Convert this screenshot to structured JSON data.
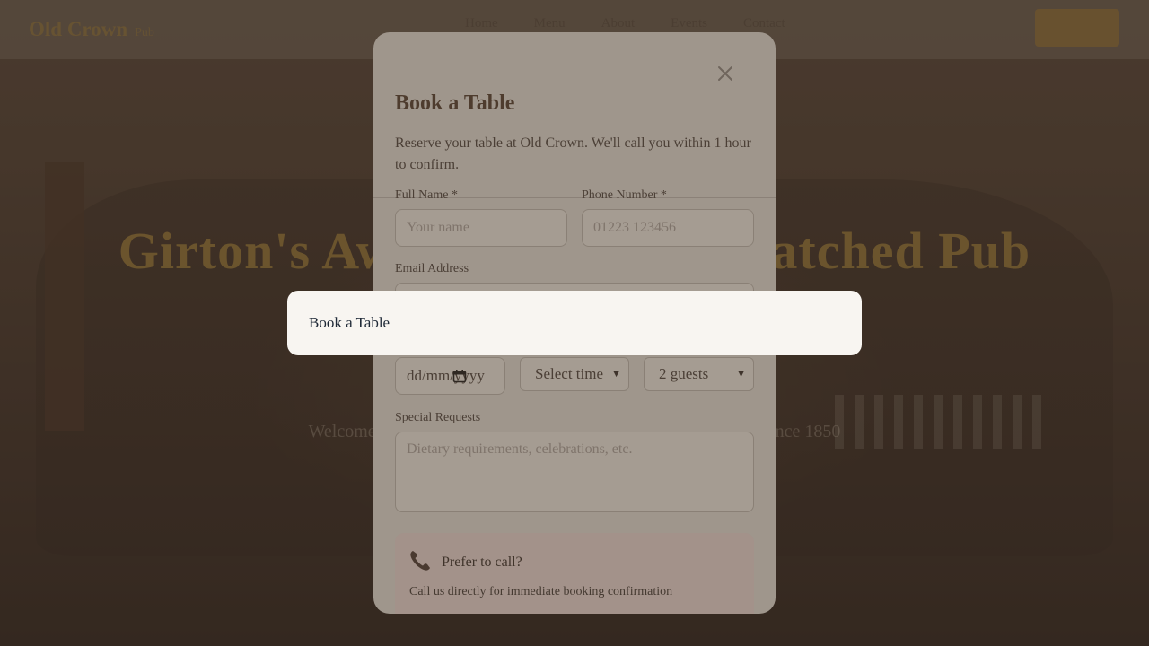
{
  "site": {
    "brand_name": "Old Crown",
    "brand_tag": "Pub",
    "nav": [
      "Home",
      "Menu",
      "About",
      "Events",
      "Contact"
    ],
    "hero_heading": "Girton's Award-Winning Thatched Pub",
    "hero_subtitle": "Welcome to Old Crown — traditional food in a historic setting since 1850"
  },
  "modal": {
    "title": "Book a Table",
    "description": "Reserve your table at Old Crown. We'll call you within 1 hour to confirm.",
    "fields": {
      "full_name": {
        "label": "Full Name *",
        "placeholder": "Your name"
      },
      "phone": {
        "label": "Phone Number *",
        "placeholder": "01223 123456"
      },
      "email": {
        "label": "Email Address"
      },
      "date": {
        "value": "dd/mm/yyyy"
      },
      "time": {
        "value": "Select time"
      },
      "guests": {
        "value": "2 guests"
      },
      "special_requests": {
        "label": "Special Requests",
        "placeholder": "Dietary requirements, celebrations, etc."
      }
    },
    "call_box": {
      "title": "Prefer to call?",
      "description": "Call us directly for immediate booking confirmation"
    }
  },
  "toast": {
    "text": "Book a Table"
  },
  "colors": {
    "accent": "#c9a24a",
    "modal_title": "#4e3c2e",
    "toast_bg": "#f8f5f1"
  }
}
